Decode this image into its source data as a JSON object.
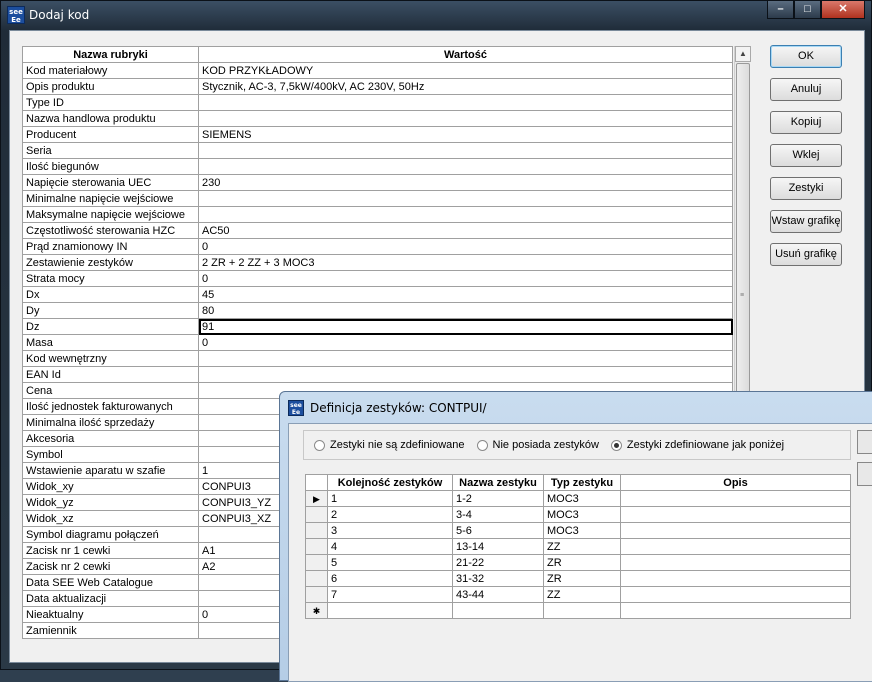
{
  "window": {
    "title": "Dodaj kod",
    "app_icon_label": "see Ee"
  },
  "grid": {
    "headers": [
      "Nazwa rubryki",
      "Wartość"
    ],
    "rows": [
      [
        "Kod materiałowy",
        "KOD PRZYKŁADOWY"
      ],
      [
        "Opis produktu",
        "Stycznik, AC-3, 7,5kW/400kV, AC 230V, 50Hz"
      ],
      [
        "Type ID",
        ""
      ],
      [
        "Nazwa handlowa produktu",
        ""
      ],
      [
        "Producent",
        "SIEMENS"
      ],
      [
        "Seria",
        ""
      ],
      [
        "Ilość biegunów",
        ""
      ],
      [
        "Napięcie sterowania UEC",
        "230"
      ],
      [
        "Minimalne napięcie wejściowe",
        ""
      ],
      [
        "Maksymalne napięcie wejściowe",
        ""
      ],
      [
        "Częstotliwość sterowania HZC",
        "AC50"
      ],
      [
        "Prąd znamionowy IN",
        "0"
      ],
      [
        "Zestawienie zestyków",
        "2 ZR + 2 ZZ + 3 MOC3"
      ],
      [
        "Strata mocy",
        "0"
      ],
      [
        "Dx",
        "45"
      ],
      [
        "Dy",
        "80"
      ],
      [
        "Dz",
        "91"
      ],
      [
        "Masa",
        "0"
      ],
      [
        "Kod wewnętrzny",
        ""
      ],
      [
        "EAN Id",
        ""
      ],
      [
        "Cena",
        ""
      ],
      [
        "Ilość jednostek fakturowanych",
        ""
      ],
      [
        "Minimalna ilość sprzedaży",
        ""
      ],
      [
        "Akcesoria",
        ""
      ],
      [
        "Symbol",
        ""
      ],
      [
        "Wstawienie aparatu w szafie",
        "1"
      ],
      [
        "Widok_xy",
        "CONPUI3"
      ],
      [
        "Widok_yz",
        "CONPUI3_YZ"
      ],
      [
        "Widok_xz",
        "CONPUI3_XZ"
      ],
      [
        "Symbol diagramu połączeń",
        ""
      ],
      [
        "Zacisk nr 1 cewki",
        "A1"
      ],
      [
        "Zacisk nr 2 cewki",
        "A2"
      ],
      [
        "Data SEE Web Catalogue",
        ""
      ],
      [
        "Data aktualizacji",
        ""
      ],
      [
        "Nieaktualny",
        "0"
      ],
      [
        "Zamiennik",
        ""
      ]
    ]
  },
  "buttons": {
    "ok": "OK",
    "cancel": "Anuluj",
    "copy": "Kopiuj",
    "paste": "Wklej",
    "contacts": "Zestyki",
    "insert_graphic": "Wstaw grafikę",
    "remove_graphic": "Usuń grafikę"
  },
  "dialog": {
    "title": "Definicja zestyków: CONTPUI/",
    "radio": {
      "option1": "Zestyki nie są zdefiniowane",
      "option2": "Nie posiada zestyków",
      "option3": "Zestyki zdefiniowane jak poniżej",
      "selected": "option3"
    },
    "table": {
      "headers": [
        "Kolejność zestyków",
        "Nazwa zestyku",
        "Typ zestyku",
        "Opis"
      ],
      "rows": [
        [
          "1",
          "1-2",
          "MOC3",
          ""
        ],
        [
          "2",
          "3-4",
          "MOC3",
          ""
        ],
        [
          "3",
          "5-6",
          "MOC3",
          ""
        ],
        [
          "4",
          "13-14",
          "ZZ",
          ""
        ],
        [
          "5",
          "21-22",
          "ZR",
          ""
        ],
        [
          "6",
          "31-32",
          "ZR",
          ""
        ],
        [
          "7",
          "43-44",
          "ZZ",
          ""
        ]
      ],
      "current_row_marker": "▶",
      "new_row_marker": "✱"
    }
  }
}
